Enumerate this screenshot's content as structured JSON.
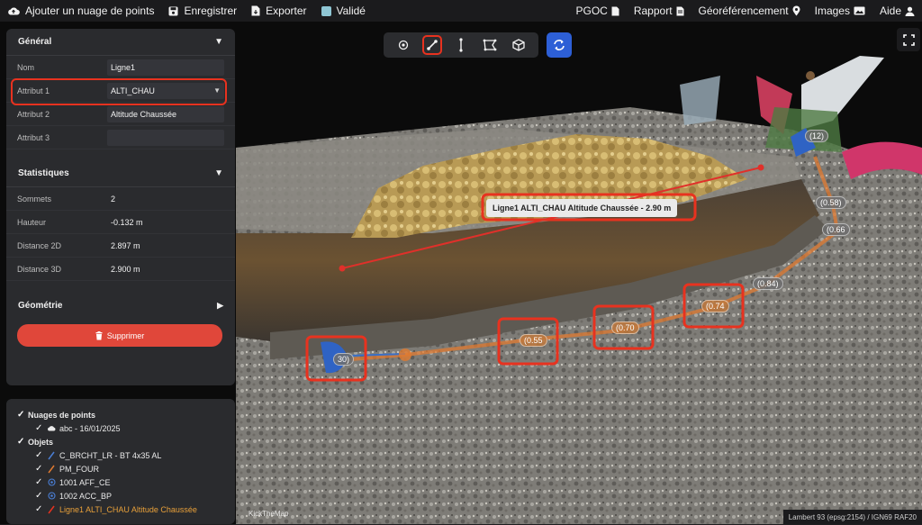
{
  "topbar": {
    "add_cloud": "Ajouter un nuage de points",
    "save": "Enregistrer",
    "export": "Exporter",
    "validated": "Validé",
    "pgoc": "PGOC",
    "report": "Rapport",
    "georef": "Géoréférencement",
    "images": "Images",
    "help": "Aide"
  },
  "general": {
    "title": "Général",
    "rows": [
      {
        "label": "Nom",
        "value": "Ligne1"
      },
      {
        "label": "Attribut 1",
        "value": "ALTI_CHAU"
      },
      {
        "label": "Attribut 2",
        "value": "Altitude Chaussée"
      },
      {
        "label": "Attribut 3",
        "value": ""
      }
    ]
  },
  "statistics": {
    "title": "Statistiques",
    "rows": [
      {
        "label": "Sommets",
        "value": "2"
      },
      {
        "label": "Hauteur",
        "value": "-0.132 m"
      },
      {
        "label": "Distance 2D",
        "value": "2.897 m"
      },
      {
        "label": "Distance 3D",
        "value": "2.900 m"
      }
    ]
  },
  "geometry": {
    "title": "Géométrie"
  },
  "delete_label": "Supprimer",
  "tree": {
    "clouds_title": "Nuages de points",
    "cloud_item": "abc - 16/01/2025",
    "objects_title": "Objets",
    "objects": [
      {
        "label": "C_BRCHT_LR - BT 4x35 AL",
        "icon": "line-icon",
        "color": "#4a7fd6"
      },
      {
        "label": "PM_FOUR",
        "icon": "line-icon",
        "color": "#e07a30"
      },
      {
        "label": "1001 AFF_CE",
        "icon": "point-icon",
        "color": "#4a7fd6"
      },
      {
        "label": "1002 ACC_BP",
        "icon": "point-icon",
        "color": "#4a7fd6"
      },
      {
        "label": "Ligne1 ALTI_CHAU Altitude Chaussée",
        "icon": "line-icon",
        "color": "#e8321f"
      }
    ]
  },
  "viewer": {
    "measure_label": "Ligne1 ALTI_CHAU Altitude Chaussée - 2.90 m",
    "points": [
      "(0.55",
      "(0.70",
      "(0.74",
      "(0.84)",
      "(0.66",
      "(0.58)",
      "(12)",
      "30)"
    ],
    "footer": "Lambert 93 (epsg:2154) / IGN69 RAF20",
    "watermark": "KickTheMap"
  },
  "colors": {
    "accent": "#2d5fd6",
    "danger": "#e0473a",
    "highlight": "#e8321f",
    "panel": "#2a2b2e"
  }
}
